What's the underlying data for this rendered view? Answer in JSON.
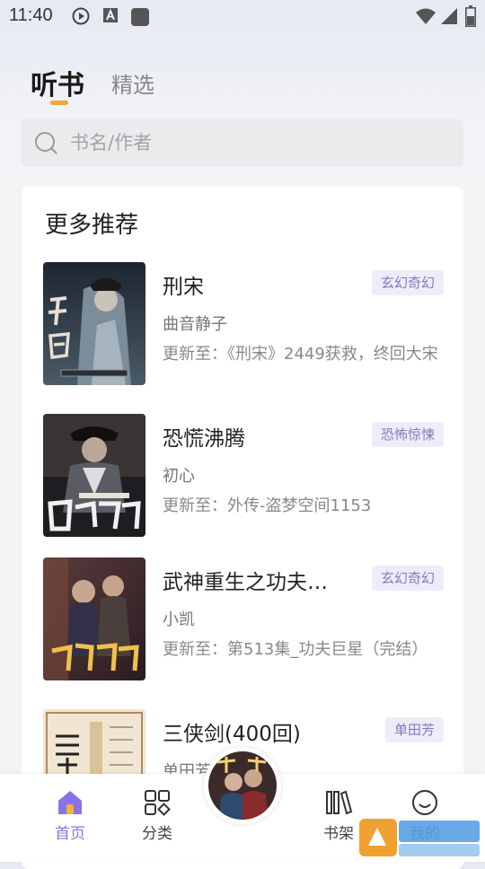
{
  "status_bar": {
    "time": "11:40"
  },
  "tabs": [
    {
      "label": "听书",
      "active": true
    },
    {
      "label": "精选",
      "active": false
    }
  ],
  "search": {
    "placeholder": "书名/作者"
  },
  "section": {
    "title": "更多推荐"
  },
  "books": [
    {
      "title": "刑宋",
      "tag": "玄幻奇幻",
      "author": "曲音静子",
      "update": "更新至：《刑宋》2449获救，终回大宋"
    },
    {
      "title": "恐慌沸腾",
      "tag": "恐怖惊悚",
      "author": "初心",
      "update": "更新至：外传-盗梦空间1153"
    },
    {
      "title": "武神重生之功夫…",
      "tag": "玄幻奇幻",
      "author": "小凯",
      "update": "更新至：第513集_功夫巨星（完结）"
    },
    {
      "title": "三侠剑(400回)",
      "tag": "单田芳",
      "author": "单田芳",
      "update": ""
    }
  ],
  "bottom_nav": [
    {
      "label": "首页",
      "icon": "home-icon",
      "active": true
    },
    {
      "label": "分类",
      "icon": "category-grid-icon",
      "active": false
    },
    {
      "label": "书架",
      "icon": "bookshelf-icon",
      "active": false
    },
    {
      "label": "我的",
      "icon": "profile-face-icon",
      "active": false
    }
  ],
  "colors": {
    "accent": "#f0a736",
    "tag_text": "#8478c2",
    "tag_bg": "#efecf9",
    "active_nav": "#8a72e6"
  }
}
